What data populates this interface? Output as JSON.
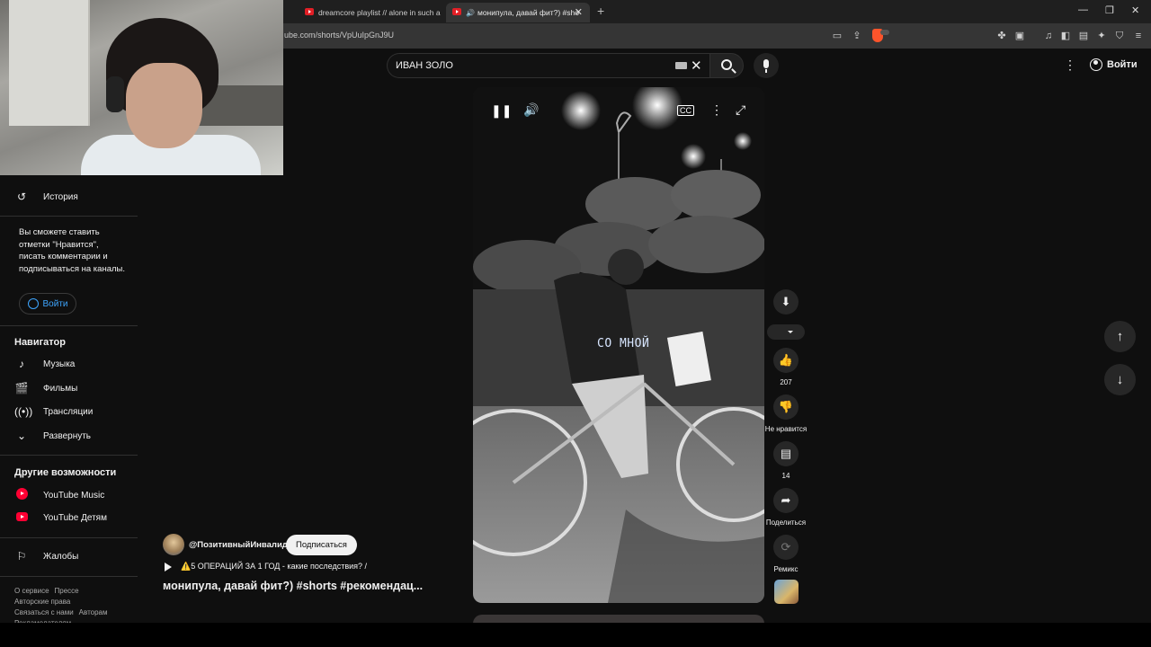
{
  "browser": {
    "tabs": [
      {
        "title": "dreamcore playlist // alone in such a"
      },
      {
        "title": "монипула, давай фит?) #sho"
      }
    ],
    "url": "ube.com/shorts/VpUuIpGnJ9U"
  },
  "header": {
    "search_value": "ИВАН ЗОЛО",
    "sign_in": "Войти"
  },
  "sidebar": {
    "history": "История",
    "note": "Вы сможете ставить отметки \"Нравится\", писать комментарии и подписываться на каналы.",
    "sign_in": "Войти",
    "navigator_title": "Навигатор",
    "navigator": [
      "Музыка",
      "Фильмы",
      "Трансляции",
      "Развернуть"
    ],
    "more_title": "Другие возможности",
    "more": [
      "YouTube Music",
      "YouTube Детям"
    ],
    "reports": "Жалобы",
    "footer": [
      "О сервисе",
      "Прессе",
      "Авторские права",
      "Связаться с нами",
      "Авторам",
      "Рекламодателям"
    ]
  },
  "video": {
    "caption": "СО МНОЙ",
    "channel": "@ПозитивныйИнвалид",
    "subscribe": "Подписаться",
    "related": "⚠️5 ОПЕРАЦИЙ ЗА 1 ГОД - какие последствия? /",
    "title": "монипула, давай фит?) #shorts #рекомендац..."
  },
  "actions": {
    "likes": "207",
    "dislike": "Не нравится",
    "comments": "14",
    "share": "Поделиться",
    "remix": "Ремикс"
  },
  "icons": {
    "pause": "pause-icon",
    "volume": "volume-icon",
    "cc": "cc-icon",
    "more": "more-vert-icon",
    "fullscreen": "fullscreen-icon"
  }
}
